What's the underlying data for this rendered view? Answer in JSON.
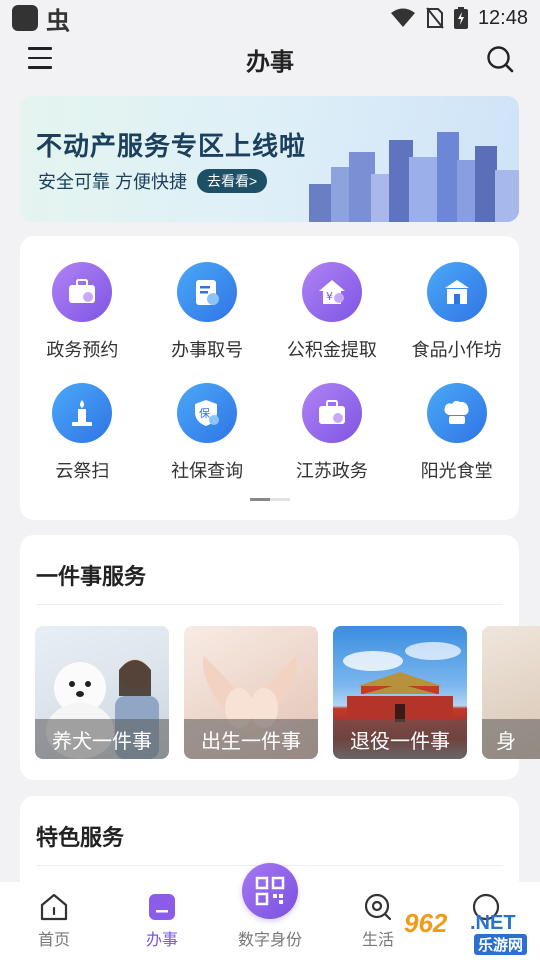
{
  "status_bar": {
    "time": "12:48",
    "app_glyph": "虫"
  },
  "header": {
    "title": "办事"
  },
  "banner": {
    "title": "不动产服务专区上线啦",
    "subtitle": "安全可靠 方便快捷",
    "button": "去看看>"
  },
  "services": [
    {
      "label": "政务预约",
      "icon": "briefcase-icon",
      "color": "purple"
    },
    {
      "label": "办事取号",
      "icon": "clipboard-user-icon",
      "color": "blue"
    },
    {
      "label": "公积金提取",
      "icon": "house-yen-icon",
      "color": "purple"
    },
    {
      "label": "食品小作坊",
      "icon": "shop-icon",
      "color": "blue"
    },
    {
      "label": "云祭扫",
      "icon": "candle-icon",
      "color": "blue"
    },
    {
      "label": "社保查询",
      "icon": "shield-search-icon",
      "color": "blue"
    },
    {
      "label": "江苏政务",
      "icon": "briefcase-icon",
      "color": "purple"
    },
    {
      "label": "阳光食堂",
      "icon": "chef-hat-icon",
      "color": "blue"
    }
  ],
  "one_item": {
    "title": "一件事服务",
    "cards": [
      {
        "caption": "养犬一件事"
      },
      {
        "caption": "出生一件事"
      },
      {
        "caption": "退役一件事"
      },
      {
        "caption": "身"
      }
    ]
  },
  "special": {
    "title": "特色服务"
  },
  "tabbar": {
    "home": "首页",
    "affairs": "办事",
    "digital_id": "数字身份",
    "life": "生活"
  },
  "watermark": {
    "num": "962",
    "net": ".NET",
    "cn": "乐游网"
  },
  "colors": {
    "accent": "#7d55e3",
    "blue": "#2f74e6"
  }
}
